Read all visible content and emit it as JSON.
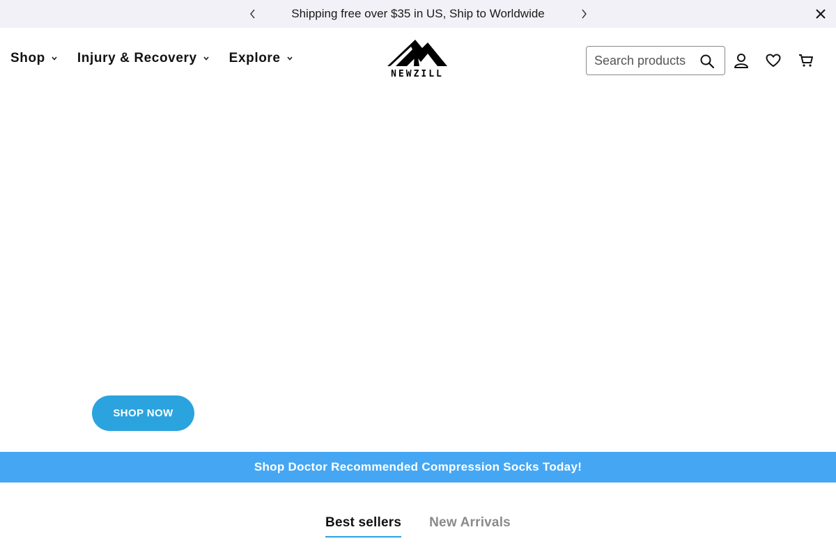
{
  "announcement": {
    "text": "Shipping free over $35 in US, Ship to Worldwide"
  },
  "header": {
    "nav": [
      {
        "label": "Shop"
      },
      {
        "label": "Injury & Recovery"
      },
      {
        "label": "Explore"
      }
    ],
    "logo_text": "NEWZILL",
    "search": {
      "placeholder": "Search products"
    }
  },
  "hero": {
    "cta_label": "SHOP NOW"
  },
  "promo": {
    "text": "Shop Doctor Recommended Compression Socks Today!"
  },
  "tabs": [
    {
      "label": "Best sellers",
      "active": true
    },
    {
      "label": "New Arrivals",
      "active": false
    }
  ],
  "colors": {
    "accent": "#2ba3de",
    "promo_bg": "#45a7f3",
    "announcement_bg": "#f1f1f7"
  }
}
